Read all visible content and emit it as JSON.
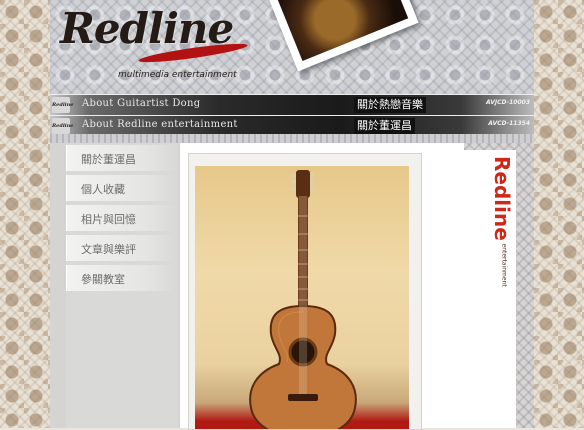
{
  "brand": {
    "logo_text": "Redline",
    "tagline": "multimedia entertainment",
    "banner_mini_logo": "Redline",
    "vertical_logo": "Redline",
    "vertical_sub": "entertainment"
  },
  "banners": [
    {
      "en": "About Guitartist Dong",
      "zh": "關於熱戀音樂",
      "code": "AVJCD-10003"
    },
    {
      "en": "About Redline entertainment",
      "zh": "關於董運昌",
      "code": "AVCD-11354"
    }
  ],
  "nav": {
    "items": [
      {
        "label": "關於董運昌"
      },
      {
        "label": "個人收藏"
      },
      {
        "label": "相片與回憶"
      },
      {
        "label": "文章與樂評"
      },
      {
        "label": "參關教室"
      }
    ]
  },
  "content": {
    "image": "acoustic-guitar-photo"
  },
  "colors": {
    "accent_red": "#d02818",
    "banner_dark": "#1a1a1a",
    "nav_text": "#6d6d6d"
  }
}
